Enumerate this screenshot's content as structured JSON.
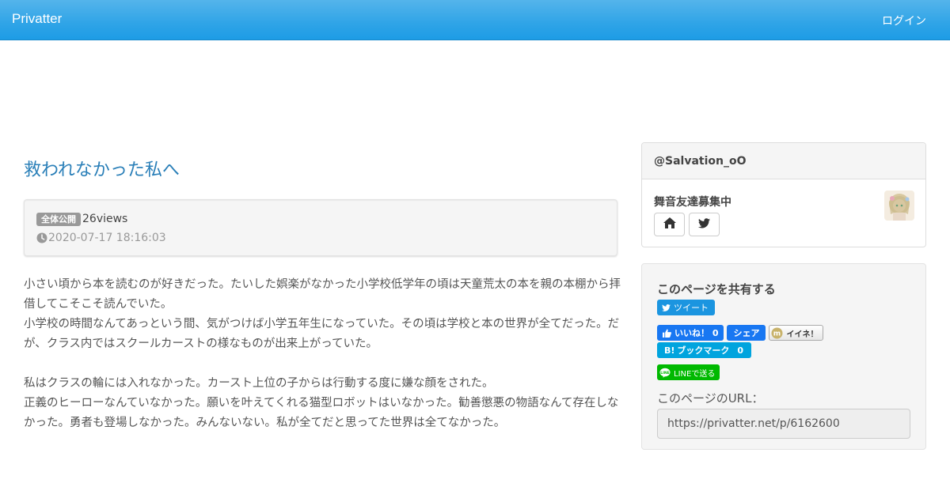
{
  "navbar": {
    "brand": "Privatter",
    "login": "ログイン",
    "bg_color": "#2fa4e7"
  },
  "post": {
    "title": "救われなかった私へ",
    "visibility_badge": "全体公開",
    "views": "26views",
    "timestamp": "2020-07-17 18:16:03",
    "paragraphs": [
      "小さい頃から本を読むのが好きだった。たいした娯楽がなかった小学校低学年の頃は天童荒太の本を親の本棚から拝借してこそこそ読んでいた。",
      "小学校の時間なんてあっという間、気がつけば小学五年生になっていた。その頃は学校と本の世界が全てだった。だが、クラス内ではスクールカーストの様なものが出来上がっていた。",
      "私はクラスの輪には入れなかった。カースト上位の子からは行動する度に嫌な顔をされた。",
      "正義のヒーローなんていなかった。願いを叶えてくれる猫型ロボットはいなかった。勧善懲悪の物語なんて存在しなかった。勇者も登場しなかった。みんないない。私が全てだと思ってた世界は全てなかった。"
    ]
  },
  "profile": {
    "handle": "@Salvation_oO",
    "name": "舞音友達募集中",
    "home_icon": "home-icon",
    "twitter_icon": "twitter-icon"
  },
  "share": {
    "title": "このページを共有する",
    "tweet": "ツイート",
    "fb_like": "いいね！ 0",
    "fb_share": "シェア",
    "iine": "イイネ！",
    "hatena": "ブックマーク",
    "hatena_count": "0",
    "line": "LINEで送る",
    "url_label": "このページのURL：",
    "url": "https://privatter.net/p/6162600"
  }
}
